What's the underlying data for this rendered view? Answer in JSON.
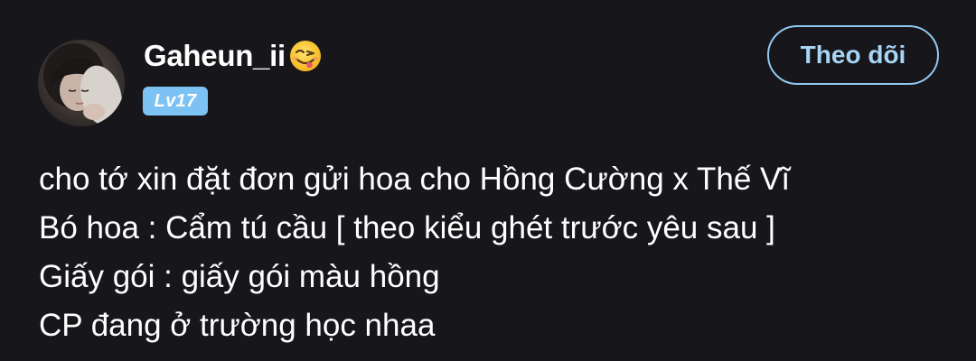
{
  "post": {
    "author": {
      "username": "Gaheun_ii",
      "emoji_icon": "face-savoring-food-emoji",
      "avatar_icon": "profile-photo-avatar",
      "level": "Lv17"
    },
    "follow_button_label": "Theo dõi",
    "content_lines": [
      "cho tớ xin đặt đơn gửi hoa cho Hồng Cường x Thế Vĩ",
      "Bó hoa : Cẩm tú cầu [ theo kiểu ghét trước yêu sau ]",
      "Giấy gói : giấy gói màu hồng",
      "CP đang ở trường học nhaa"
    ]
  },
  "colors": {
    "background": "#17161a",
    "text": "#ffffff",
    "accent": "#8fc9f0",
    "level_badge": "#7cc2f2"
  }
}
